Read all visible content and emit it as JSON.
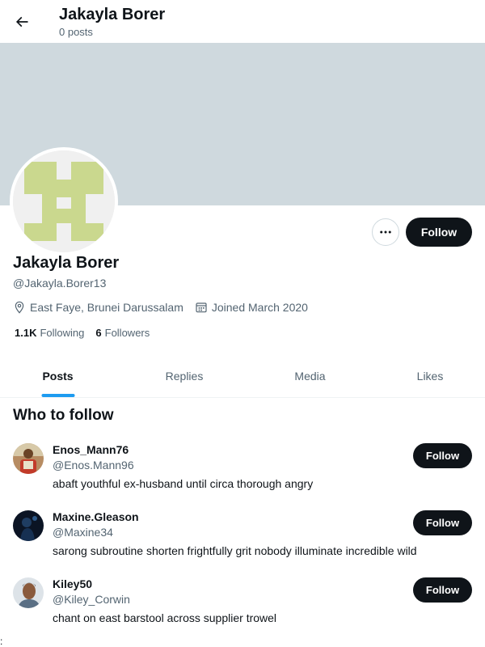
{
  "header": {
    "name": "Jakayla Borer",
    "post_count": "0 posts",
    "back_icon": "arrow-left-icon"
  },
  "profile": {
    "display_name": "Jakayla Borer",
    "handle": "@Jakayla.Borer13",
    "location": "East Faye, Brunei Darussalam",
    "joined": "Joined March 2020",
    "following_count": "1.1K",
    "following_label": "Following",
    "followers_count": "6",
    "followers_label": "Followers",
    "follow_label": "Follow",
    "avatar_color": "#cad88e",
    "banner_color": "#cfd9de"
  },
  "tabs": [
    {
      "label": "Posts",
      "active": true
    },
    {
      "label": "Replies",
      "active": false
    },
    {
      "label": "Media",
      "active": false
    },
    {
      "label": "Likes",
      "active": false
    }
  ],
  "who_to_follow": {
    "title": "Who to follow",
    "items": [
      {
        "name": "Enos_Mann76",
        "handle": "@Enos.Mann96",
        "bio": "abaft youthful ex-husband until circa thorough angry",
        "follow_label": "Follow"
      },
      {
        "name": "Maxine.Gleason",
        "handle": "@Maxine34",
        "bio": "sarong subroutine shorten frightfully grit nobody illuminate incredible wild",
        "follow_label": "Follow"
      },
      {
        "name": "Kiley50",
        "handle": "@Kiley_Corwin",
        "bio": "chant on east barstool across supplier trowel",
        "follow_label": "Follow"
      }
    ]
  },
  "footer_mark": ":",
  "colors": {
    "accent": "#1d9bf0",
    "button_dark": "#0f1419",
    "muted_text": "#536471"
  }
}
